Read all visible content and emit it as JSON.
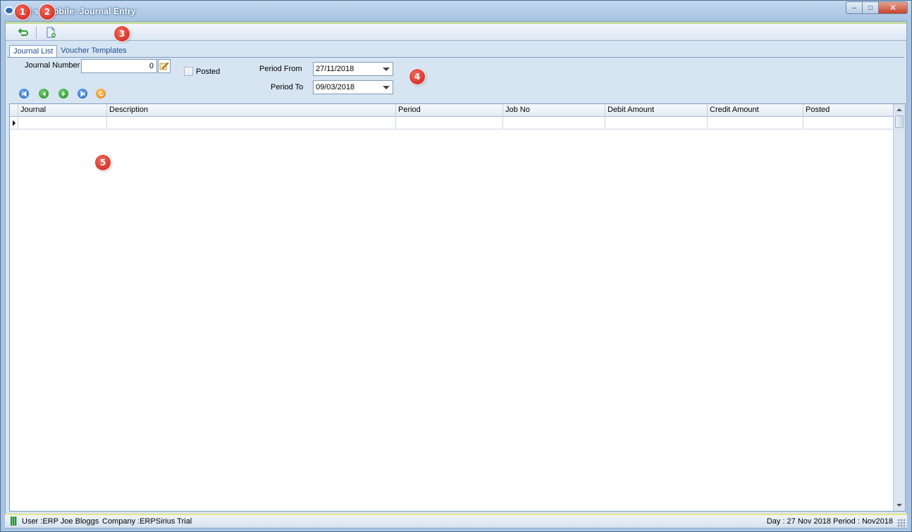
{
  "window": {
    "title": "ERP Sirius +Mobile: Journal Entry",
    "title_visible": "P S    s +Mobile: Journal Entry",
    "controls": {
      "minimize": "–",
      "maximize": "□",
      "close": "✕"
    }
  },
  "toolbar": {
    "buttons": [
      {
        "name": "back-button",
        "icon": "return-arrow-icon"
      },
      {
        "name": "new-document-button",
        "icon": "new-document-icon"
      }
    ]
  },
  "tabs": [
    {
      "label": "Journal List",
      "active": true
    },
    {
      "label": "Voucher Templates",
      "active": false
    }
  ],
  "filters": {
    "journal_number_label": "Journal Number",
    "journal_number_value": "0",
    "posted_label": "Posted",
    "posted_checked": false,
    "period_from_label": "Period From",
    "period_from_value": "27/11/2018",
    "period_to_label": "Period To",
    "period_to_value": "09/03/2018"
  },
  "navigation": {
    "buttons": [
      "first-record",
      "previous-record",
      "next-record",
      "last-record",
      "refresh"
    ]
  },
  "grid": {
    "columns": [
      "Journal",
      "Description",
      "Period",
      "Job No",
      "Debit Amount",
      "Credit Amount",
      "Posted"
    ],
    "rows": [
      [
        "",
        "",
        "",
        "",
        "",
        "",
        ""
      ]
    ]
  },
  "status": {
    "user": "User :ERP Joe Bloggs",
    "company": "Company :ERPSirius Trial",
    "day_period": "Day : 27 Nov 2018  Period : Nov2018"
  },
  "markers": [
    "1",
    "2",
    "3",
    "4",
    "5"
  ],
  "colors": {
    "title_bar": "#a7c2e2",
    "close_button": "#c6422a",
    "marker": "#d7281e",
    "panel": "#d7e4f2",
    "status_accent": "#e5e882"
  }
}
